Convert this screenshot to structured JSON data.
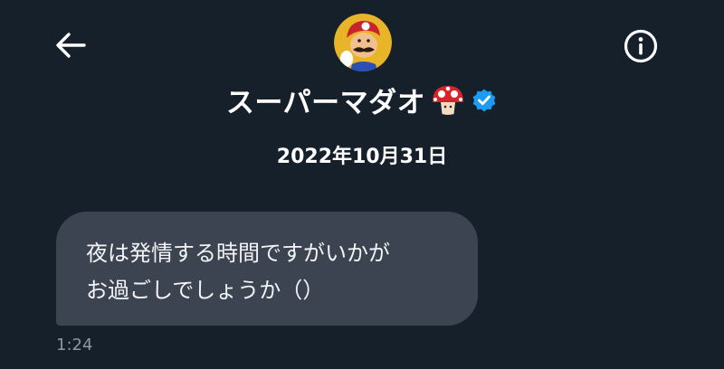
{
  "header": {
    "back_icon": "arrow-left-icon",
    "info_icon": "info-circle-icon",
    "display_name": "スーパーマダオ",
    "name_emoji": "mushroom-emoji",
    "verified_icon": "verified-badge-icon",
    "verified_color": "#1d9bf0"
  },
  "conversation": {
    "date": "2022年10月31日",
    "messages": [
      {
        "lines": [
          "夜は発情する時間ですがいかが",
          "お過ごしでしょうか（）"
        ],
        "time": "1:24"
      }
    ]
  },
  "colors": {
    "background": "#15202b",
    "bubble": "#3b4450",
    "timestamp": "#8b98a5"
  }
}
